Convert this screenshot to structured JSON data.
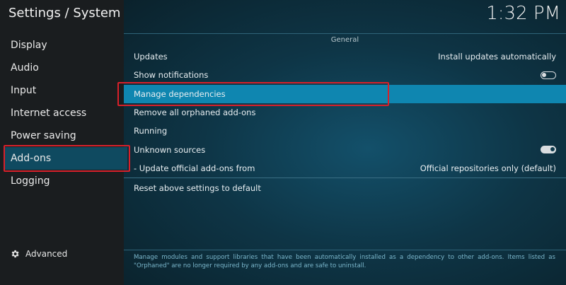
{
  "header": {
    "title": "Settings / System",
    "clock": "1:32 PM"
  },
  "sidebar": {
    "items": [
      {
        "label": "Display"
      },
      {
        "label": "Audio"
      },
      {
        "label": "Input"
      },
      {
        "label": "Internet access"
      },
      {
        "label": "Power saving"
      },
      {
        "label": "Add-ons",
        "active": true
      },
      {
        "label": "Logging"
      }
    ],
    "advanced_label": "Advanced",
    "advanced_icon": "gear-icon"
  },
  "panel": {
    "section_title": "General",
    "rows": [
      {
        "label": "Updates",
        "value": "Install updates automatically"
      },
      {
        "label": "Show notifications",
        "toggle": "off"
      },
      {
        "label": "Manage dependencies",
        "focused": true
      },
      {
        "label": "Remove all orphaned add-ons"
      },
      {
        "label": "Running"
      },
      {
        "label": "Unknown sources",
        "toggle": "on"
      },
      {
        "label": "- Update official add-ons from",
        "value": "Official repositories only (default)"
      }
    ],
    "reset_label": "Reset above settings to default",
    "help_text": "Manage modules and support libraries that have been automatically installed as a dependency to other add-ons. Items listed as \"Orphaned\" are no longer required by any add-ons and are safe to uninstall."
  },
  "colors": {
    "focus": "#0f86b0",
    "highlight_outline": "#d8202a",
    "sidebar_bg": "#1a1d1f"
  }
}
